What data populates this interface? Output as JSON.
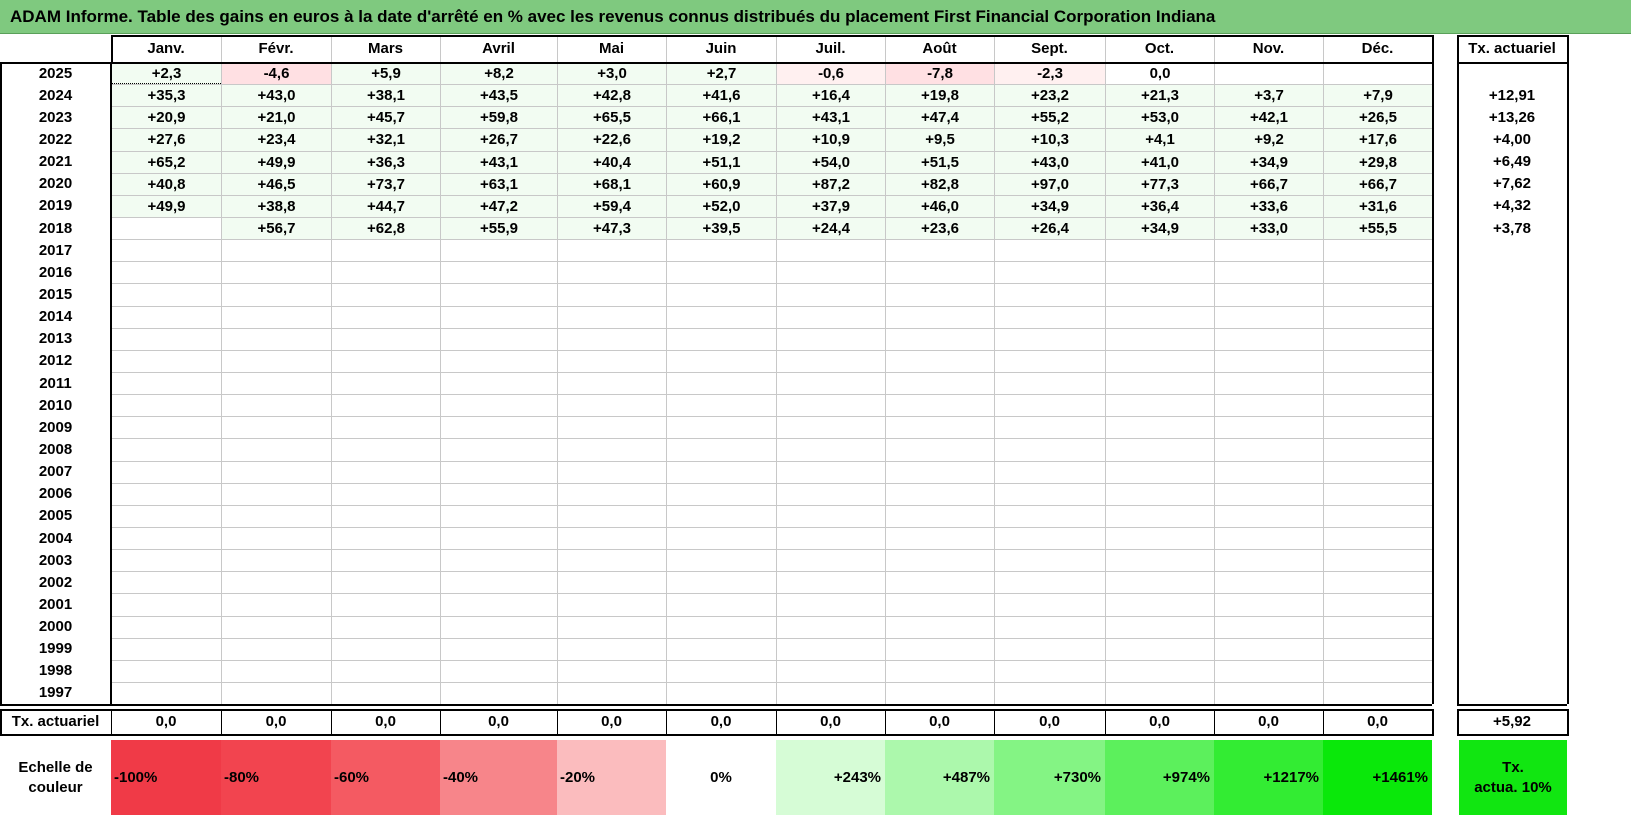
{
  "title": "ADAM Informe. Table des gains en euros à la date d'arrêté en % avec les revenus connus distribués du placement First Financial Corporation Indiana",
  "months": [
    "Janv.",
    "Févr.",
    "Mars",
    "Avril",
    "Mai",
    "Juin",
    "Juil.",
    "Août",
    "Sept.",
    "Oct.",
    "Nov.",
    "Déc."
  ],
  "rate_header": "Tx. actuariel",
  "rows": [
    {
      "year": "2025",
      "values": [
        "+2,3",
        "-4,6",
        "+5,9",
        "+8,2",
        "+3,0",
        "+2,7",
        "-0,6",
        "-7,8",
        "-2,3",
        "0,0",
        "",
        ""
      ],
      "rate": ""
    },
    {
      "year": "2024",
      "values": [
        "+35,3",
        "+43,0",
        "+38,1",
        "+43,5",
        "+42,8",
        "+41,6",
        "+16,4",
        "+19,8",
        "+23,2",
        "+21,3",
        "+3,7",
        "+7,9"
      ],
      "rate": "+12,91"
    },
    {
      "year": "2023",
      "values": [
        "+20,9",
        "+21,0",
        "+45,7",
        "+59,8",
        "+65,5",
        "+66,1",
        "+43,1",
        "+47,4",
        "+55,2",
        "+53,0",
        "+42,1",
        "+26,5"
      ],
      "rate": "+13,26"
    },
    {
      "year": "2022",
      "values": [
        "+27,6",
        "+23,4",
        "+32,1",
        "+26,7",
        "+22,6",
        "+19,2",
        "+10,9",
        "+9,5",
        "+10,3",
        "+4,1",
        "+9,2",
        "+17,6"
      ],
      "rate": "+4,00"
    },
    {
      "year": "2021",
      "values": [
        "+65,2",
        "+49,9",
        "+36,3",
        "+43,1",
        "+40,4",
        "+51,1",
        "+54,0",
        "+51,5",
        "+43,0",
        "+41,0",
        "+34,9",
        "+29,8"
      ],
      "rate": "+6,49"
    },
    {
      "year": "2020",
      "values": [
        "+40,8",
        "+46,5",
        "+73,7",
        "+63,1",
        "+68,1",
        "+60,9",
        "+87,2",
        "+82,8",
        "+97,0",
        "+77,3",
        "+66,7",
        "+66,7"
      ],
      "rate": "+7,62"
    },
    {
      "year": "2019",
      "values": [
        "+49,9",
        "+38,8",
        "+44,7",
        "+47,2",
        "+59,4",
        "+52,0",
        "+37,9",
        "+46,0",
        "+34,9",
        "+36,4",
        "+33,6",
        "+31,6"
      ],
      "rate": "+4,32"
    },
    {
      "year": "2018",
      "values": [
        "",
        "+56,7",
        "+62,8",
        "+55,9",
        "+47,3",
        "+39,5",
        "+24,4",
        "+23,6",
        "+26,4",
        "+34,9",
        "+33,0",
        "+55,5"
      ],
      "rate": "+3,78"
    },
    {
      "year": "2017",
      "values": [
        "",
        "",
        "",
        "",
        "",
        "",
        "",
        "",
        "",
        "",
        "",
        ""
      ],
      "rate": ""
    },
    {
      "year": "2016",
      "values": [
        "",
        "",
        "",
        "",
        "",
        "",
        "",
        "",
        "",
        "",
        "",
        ""
      ],
      "rate": ""
    },
    {
      "year": "2015",
      "values": [
        "",
        "",
        "",
        "",
        "",
        "",
        "",
        "",
        "",
        "",
        "",
        ""
      ],
      "rate": ""
    },
    {
      "year": "2014",
      "values": [
        "",
        "",
        "",
        "",
        "",
        "",
        "",
        "",
        "",
        "",
        "",
        ""
      ],
      "rate": ""
    },
    {
      "year": "2013",
      "values": [
        "",
        "",
        "",
        "",
        "",
        "",
        "",
        "",
        "",
        "",
        "",
        ""
      ],
      "rate": ""
    },
    {
      "year": "2012",
      "values": [
        "",
        "",
        "",
        "",
        "",
        "",
        "",
        "",
        "",
        "",
        "",
        ""
      ],
      "rate": ""
    },
    {
      "year": "2011",
      "values": [
        "",
        "",
        "",
        "",
        "",
        "",
        "",
        "",
        "",
        "",
        "",
        ""
      ],
      "rate": ""
    },
    {
      "year": "2010",
      "values": [
        "",
        "",
        "",
        "",
        "",
        "",
        "",
        "",
        "",
        "",
        "",
        ""
      ],
      "rate": ""
    },
    {
      "year": "2009",
      "values": [
        "",
        "",
        "",
        "",
        "",
        "",
        "",
        "",
        "",
        "",
        "",
        ""
      ],
      "rate": ""
    },
    {
      "year": "2008",
      "values": [
        "",
        "",
        "",
        "",
        "",
        "",
        "",
        "",
        "",
        "",
        "",
        ""
      ],
      "rate": ""
    },
    {
      "year": "2007",
      "values": [
        "",
        "",
        "",
        "",
        "",
        "",
        "",
        "",
        "",
        "",
        "",
        ""
      ],
      "rate": ""
    },
    {
      "year": "2006",
      "values": [
        "",
        "",
        "",
        "",
        "",
        "",
        "",
        "",
        "",
        "",
        "",
        ""
      ],
      "rate": ""
    },
    {
      "year": "2005",
      "values": [
        "",
        "",
        "",
        "",
        "",
        "",
        "",
        "",
        "",
        "",
        "",
        ""
      ],
      "rate": ""
    },
    {
      "year": "2004",
      "values": [
        "",
        "",
        "",
        "",
        "",
        "",
        "",
        "",
        "",
        "",
        "",
        ""
      ],
      "rate": ""
    },
    {
      "year": "2003",
      "values": [
        "",
        "",
        "",
        "",
        "",
        "",
        "",
        "",
        "",
        "",
        "",
        ""
      ],
      "rate": ""
    },
    {
      "year": "2002",
      "values": [
        "",
        "",
        "",
        "",
        "",
        "",
        "",
        "",
        "",
        "",
        "",
        ""
      ],
      "rate": ""
    },
    {
      "year": "2001",
      "values": [
        "",
        "",
        "",
        "",
        "",
        "",
        "",
        "",
        "",
        "",
        "",
        ""
      ],
      "rate": ""
    },
    {
      "year": "2000",
      "values": [
        "",
        "",
        "",
        "",
        "",
        "",
        "",
        "",
        "",
        "",
        "",
        ""
      ],
      "rate": ""
    },
    {
      "year": "1999",
      "values": [
        "",
        "",
        "",
        "",
        "",
        "",
        "",
        "",
        "",
        "",
        "",
        ""
      ],
      "rate": ""
    },
    {
      "year": "1998",
      "values": [
        "",
        "",
        "",
        "",
        "",
        "",
        "",
        "",
        "",
        "",
        "",
        ""
      ],
      "rate": ""
    },
    {
      "year": "1997",
      "values": [
        "",
        "",
        "",
        "",
        "",
        "",
        "",
        "",
        "",
        "",
        "",
        ""
      ],
      "rate": ""
    }
  ],
  "summary": {
    "label": "Tx. actuariel",
    "values": [
      "0,0",
      "0,0",
      "0,0",
      "0,0",
      "0,0",
      "0,0",
      "0,0",
      "0,0",
      "0,0",
      "0,0",
      "0,0",
      "0,0"
    ],
    "rate": "+5,92"
  },
  "legend": {
    "label_line1": "Echelle de",
    "label_line2": "couleur",
    "items": [
      {
        "text": "-100%",
        "color": "#f03a47"
      },
      {
        "text": "-80%",
        "color": "#f2444f"
      },
      {
        "text": "-60%",
        "color": "#f45a62"
      },
      {
        "text": "-40%",
        "color": "#f7858a"
      },
      {
        "text": "-20%",
        "color": "#fbbcbe"
      },
      {
        "text": "0%",
        "color": "#ffffff"
      },
      {
        "text": "+243%",
        "color": "#d6fcd6"
      },
      {
        "text": "+487%",
        "color": "#acf8ac"
      },
      {
        "text": "+730%",
        "color": "#84f484"
      },
      {
        "text": "+974%",
        "color": "#5cf05c"
      },
      {
        "text": "+1217%",
        "color": "#33ec33"
      },
      {
        "text": "+1461%",
        "color": "#0ae80a"
      }
    ],
    "rate_line1": "Tx.",
    "rate_line2": "actua. 10%",
    "rate_color": "#11e611"
  },
  "colors": {
    "title_bg": "#7fc97f",
    "pos_fill": "#f2fcf2",
    "neg_light": "#fff0f0",
    "neg_medium": "#ffe0e3"
  }
}
